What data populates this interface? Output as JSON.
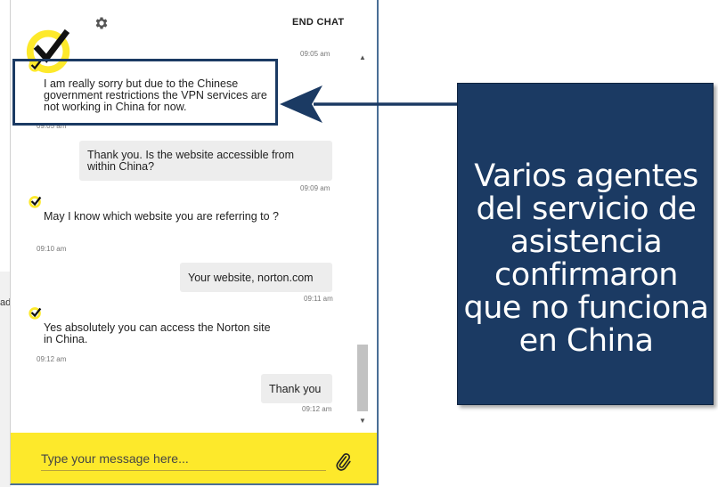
{
  "backdrop": {
    "fragment": "ad"
  },
  "header": {
    "end_chat_label": "END CHAT"
  },
  "messages": [
    {
      "sender": "agent",
      "text": "I am really sorry but due to the Chinese government restrictions the VPN services are not working in China for now.",
      "time_top": "09:05 am",
      "time": "09:05 am"
    },
    {
      "sender": "user",
      "text": "Thank you. Is the website accessible from within China?",
      "time": "09:09 am"
    },
    {
      "sender": "agent",
      "text": "May I know which website you are referring to ?",
      "time": "09:10 am"
    },
    {
      "sender": "user",
      "text": "Your website, norton.com",
      "time": "09:11 am"
    },
    {
      "sender": "agent",
      "text": "Yes absolutely you can access the Norton site in China.",
      "time": "09:12 am"
    },
    {
      "sender": "user",
      "text": "Thank you",
      "time": "09:12 am"
    }
  ],
  "input": {
    "placeholder": "Type your message here..."
  },
  "annotation": {
    "text": "Varios agentes\ndel servicio de\nasistencia\n confirmaron\nque no funciona\nen China"
  },
  "colors": {
    "accent_yellow": "#fde92b",
    "annotation_navy": "#1b3a63",
    "bubble_gray": "#ededed"
  },
  "icons": [
    "gear-icon",
    "norton-check-logo",
    "paperclip-icon",
    "arrow-left-icon"
  ]
}
